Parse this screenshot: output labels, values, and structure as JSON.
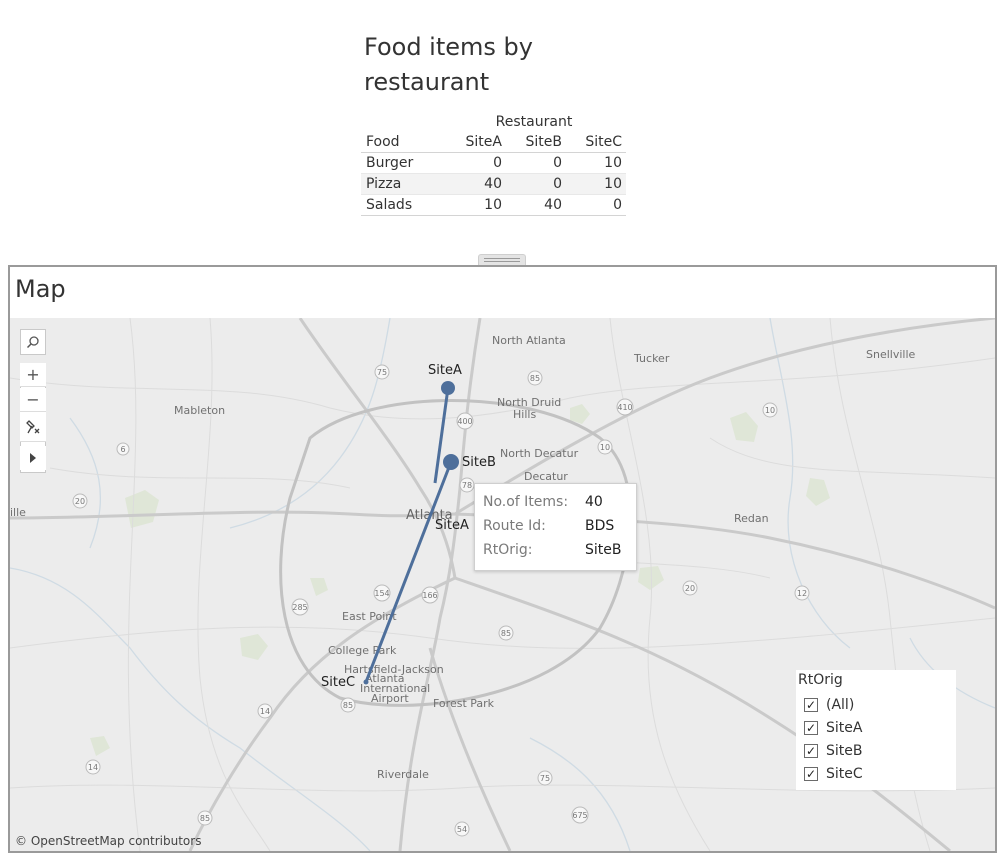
{
  "table_sheet": {
    "title": "Food items by restaurant",
    "column_group_label": "Restaurant",
    "row_header": "Food",
    "columns": [
      "SiteA",
      "SiteB",
      "SiteC"
    ],
    "rows": [
      {
        "food": "Burger",
        "values": [
          "0",
          "0",
          "10"
        ]
      },
      {
        "food": "Pizza",
        "values": [
          "40",
          "0",
          "10"
        ]
      },
      {
        "food": "Salads",
        "values": [
          "10",
          "40",
          "0"
        ]
      }
    ]
  },
  "map_sheet": {
    "title": "Map",
    "attribution": "© OpenStreetMap contributors",
    "route_color": "#4e6f9b",
    "sites": {
      "site_a_top": "SiteA",
      "site_b": "SiteB",
      "site_a_mid": "SiteA",
      "site_c": "SiteC"
    },
    "places": {
      "north_atlanta": "North Atlanta",
      "tucker": "Tucker",
      "snellville": "Snellville",
      "mableton": "Mableton",
      "north_druid_hills_1": "North Druid",
      "north_druid_hills_2": "Hills",
      "north_decatur": "North Decatur",
      "decatur": "Decatur",
      "atlanta": "Atlanta",
      "redan": "Redan",
      "east_point": "East Point",
      "college_park": "College Park",
      "airport_1": "Hartsfield-Jackson",
      "airport_2": "Atlanta",
      "airport_3": "International",
      "airport_4": "Airport",
      "forest_park": "Forest Park",
      "riverdale": "Riverdale",
      "ille": "ille"
    },
    "highway_shields": [
      "75",
      "85",
      "400",
      "410",
      "10",
      "6",
      "20",
      "285",
      "78",
      "154",
      "166",
      "20",
      "12",
      "14",
      "85",
      "14",
      "85",
      "75",
      "675",
      "54",
      "85",
      "10"
    ],
    "tooltip": {
      "items_label": "No.of Items:",
      "items_value": "40",
      "route_label": "Route Id:",
      "route_value": "BDS",
      "origin_label": "RtOrig:",
      "origin_value": "SiteB"
    },
    "filter": {
      "title": "RtOrig",
      "options": [
        "(All)",
        "SiteA",
        "SiteB",
        "SiteC"
      ],
      "checked": [
        true,
        true,
        true,
        true
      ]
    }
  }
}
